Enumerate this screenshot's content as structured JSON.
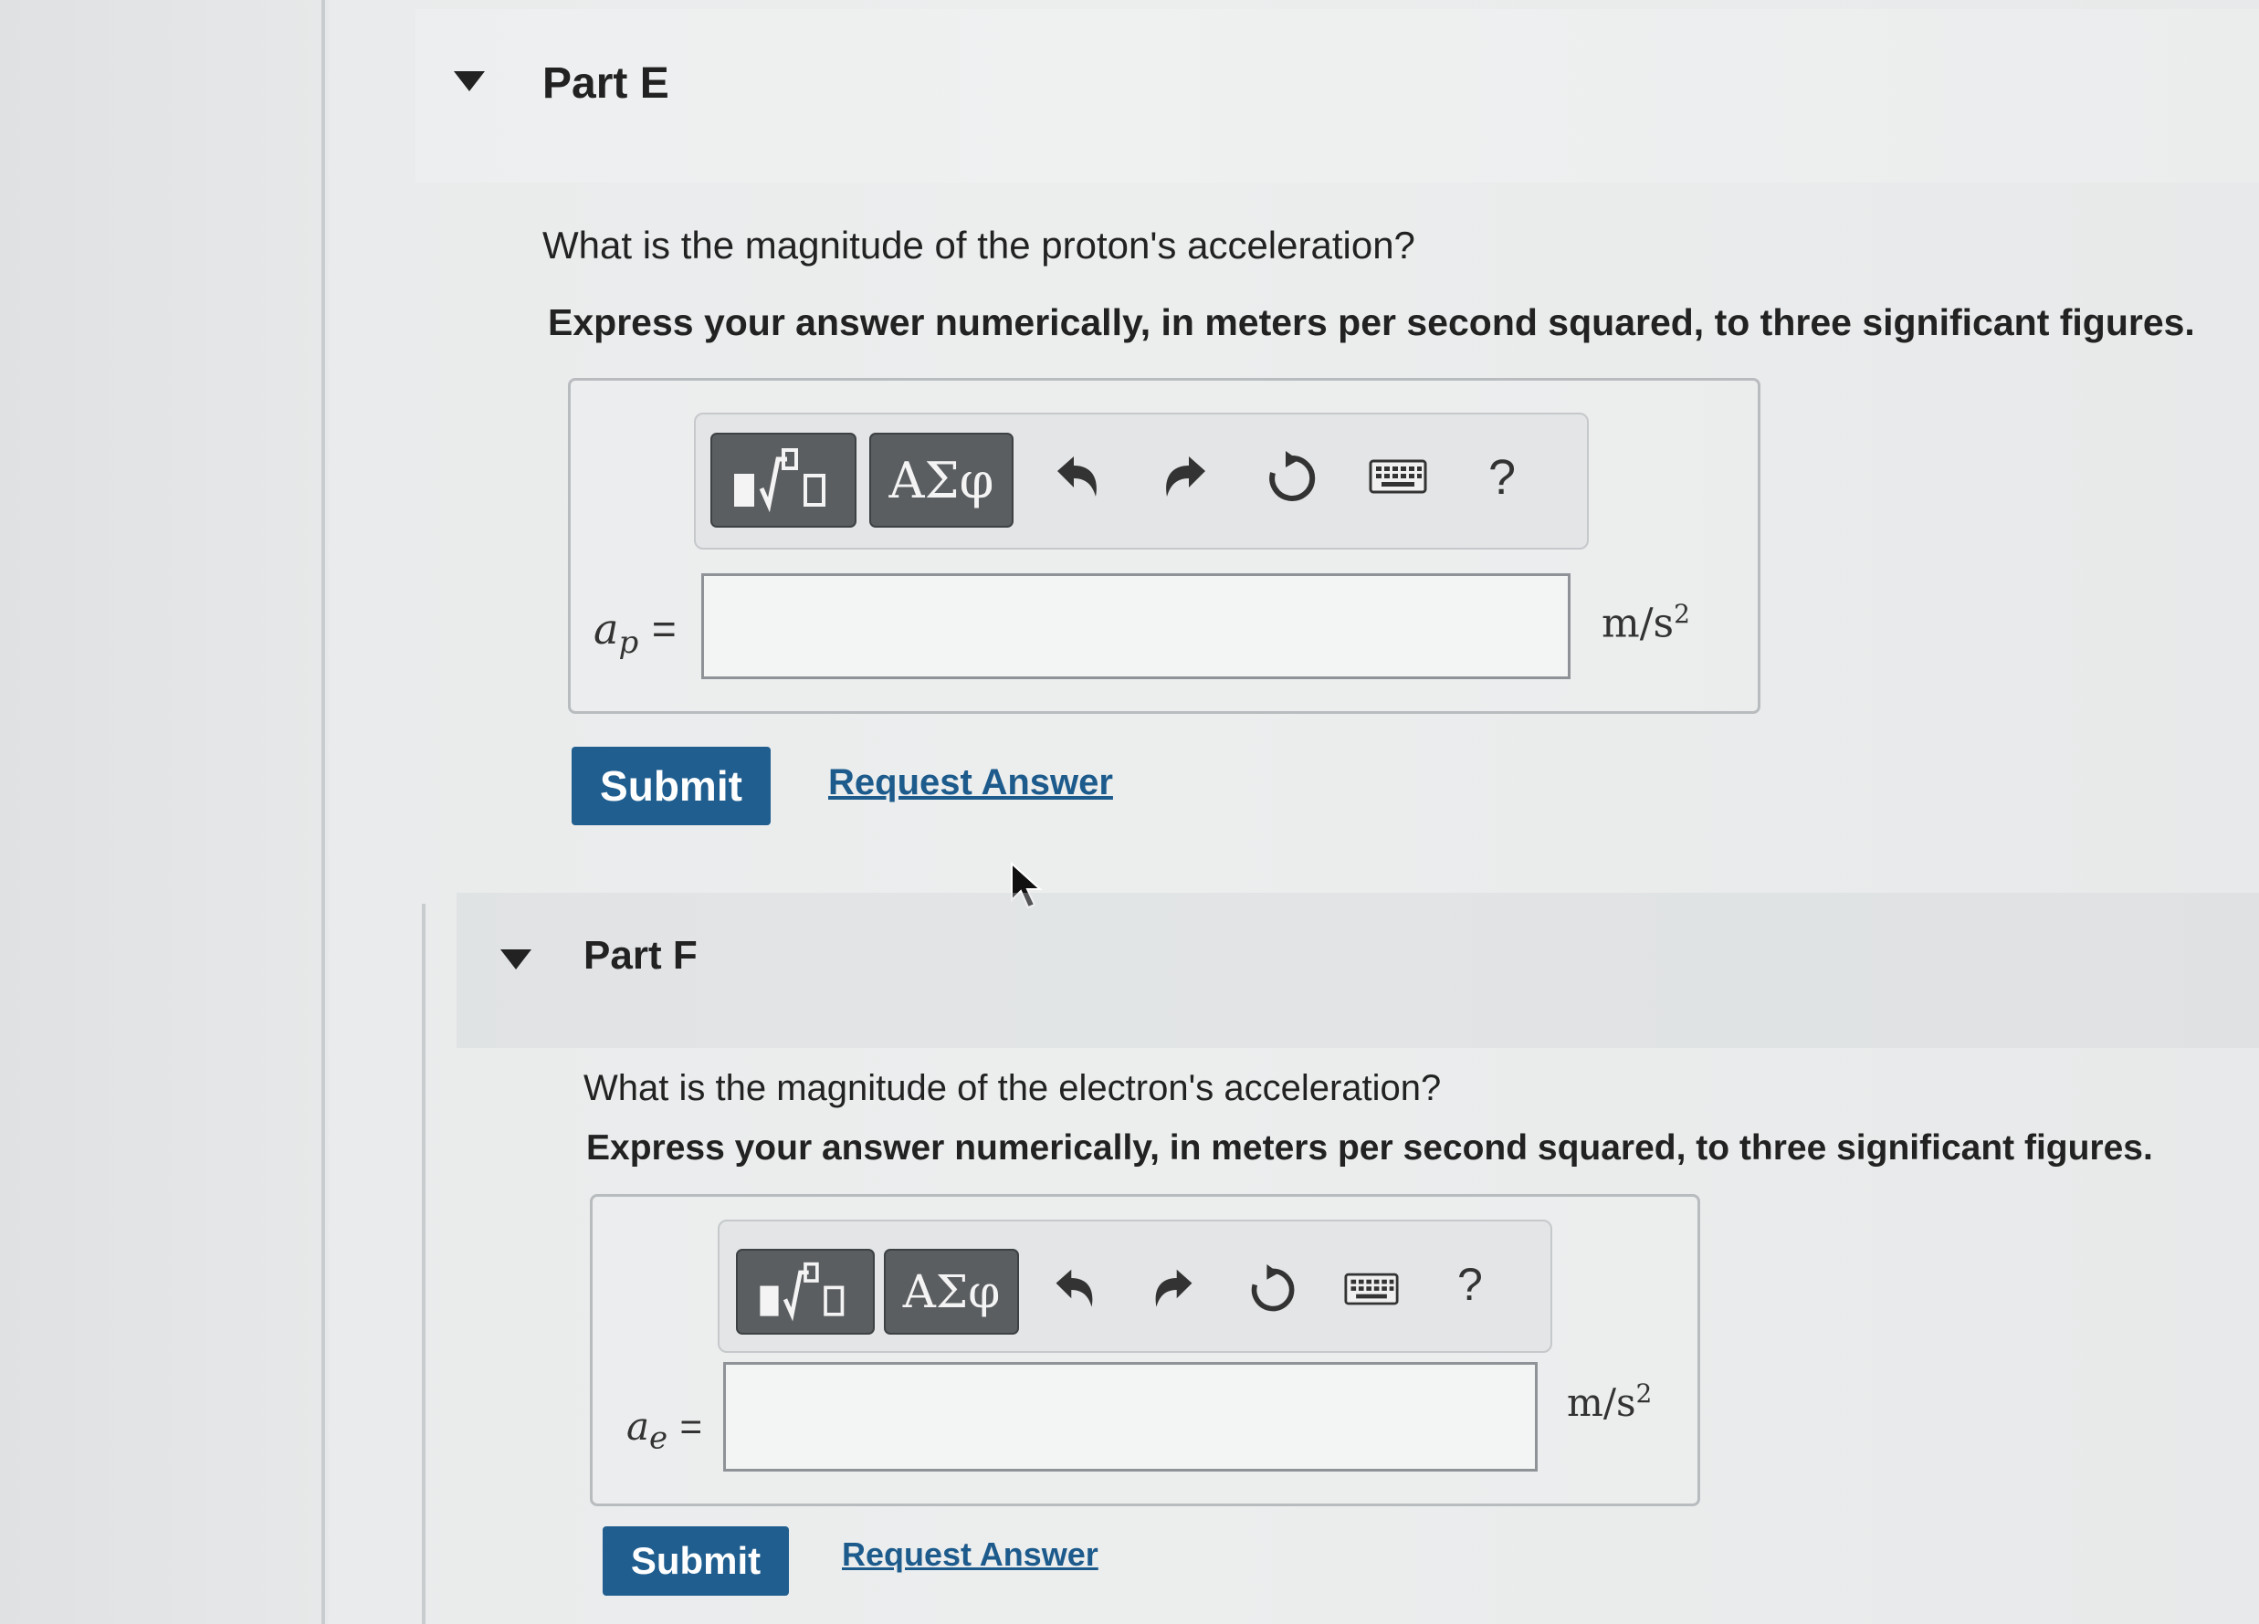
{
  "partE": {
    "title": "Part E",
    "question": "What is the magnitude of the proton's acceleration?",
    "instruction": "Express your answer numerically, in meters per second squared, to three significant figures.",
    "toolbar": {
      "template_icon": "fraction-radical-icon",
      "greek_label": "ΑΣφ",
      "undo_icon": "undo-icon",
      "redo_icon": "redo-icon",
      "reset_icon": "reset-icon",
      "keyboard_icon": "keyboard-icon",
      "help_label": "?"
    },
    "variable": "a",
    "variable_sub": "p",
    "equals": "=",
    "input_value": "",
    "unit_base": "m/s",
    "unit_exp": "2",
    "submit_label": "Submit",
    "request_label": "Request Answer"
  },
  "partF": {
    "title": "Part F",
    "question": "What is the magnitude of the electron's acceleration?",
    "instruction": "Express your answer numerically, in meters per second squared, to three significant figures.",
    "toolbar": {
      "template_icon": "fraction-radical-icon",
      "greek_label": "ΑΣφ",
      "undo_icon": "undo-icon",
      "redo_icon": "redo-icon",
      "reset_icon": "reset-icon",
      "keyboard_icon": "keyboard-icon",
      "help_label": "?"
    },
    "variable": "a",
    "variable_sub": "e",
    "equals": "=",
    "input_value": "",
    "unit_base": "m/s",
    "unit_exp": "2",
    "submit_label": "Submit",
    "request_label": "Request Answer"
  },
  "colors": {
    "submit_bg": "#1f5e8f",
    "link": "#1d5b8c",
    "toolbar_button": "#5b5e61"
  }
}
